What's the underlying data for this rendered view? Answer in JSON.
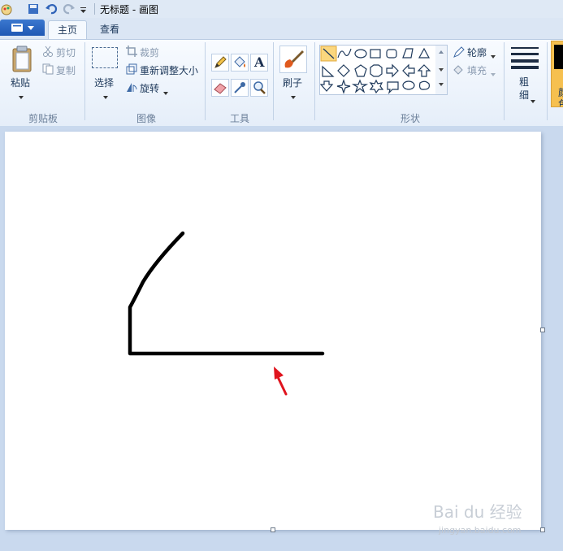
{
  "window": {
    "title": "无标题 - 画图"
  },
  "tabs": {
    "home": "主页",
    "view": "查看"
  },
  "clipboard": {
    "paste": "粘贴",
    "cut": "剪切",
    "copy": "复制",
    "group": "剪贴板"
  },
  "image": {
    "select": "选择",
    "crop": "裁剪",
    "resize": "重新调整大小",
    "rotate": "旋转",
    "group": "图像"
  },
  "tools": {
    "group": "工具",
    "text_glyph": "A"
  },
  "brushes": {
    "label": "刷子"
  },
  "shapes": {
    "group": "形状",
    "outline": "轮廓",
    "fill": "填充"
  },
  "size": {
    "label": "粗细"
  },
  "colors": {
    "partial_label": "颜色"
  },
  "watermark": {
    "brand": "Bai du 经验",
    "url": "jingyan.baidu.com"
  },
  "accent": {
    "file_button": "#2d68c4",
    "highlight": "#f6c04f",
    "arrow": "#e0141e"
  }
}
